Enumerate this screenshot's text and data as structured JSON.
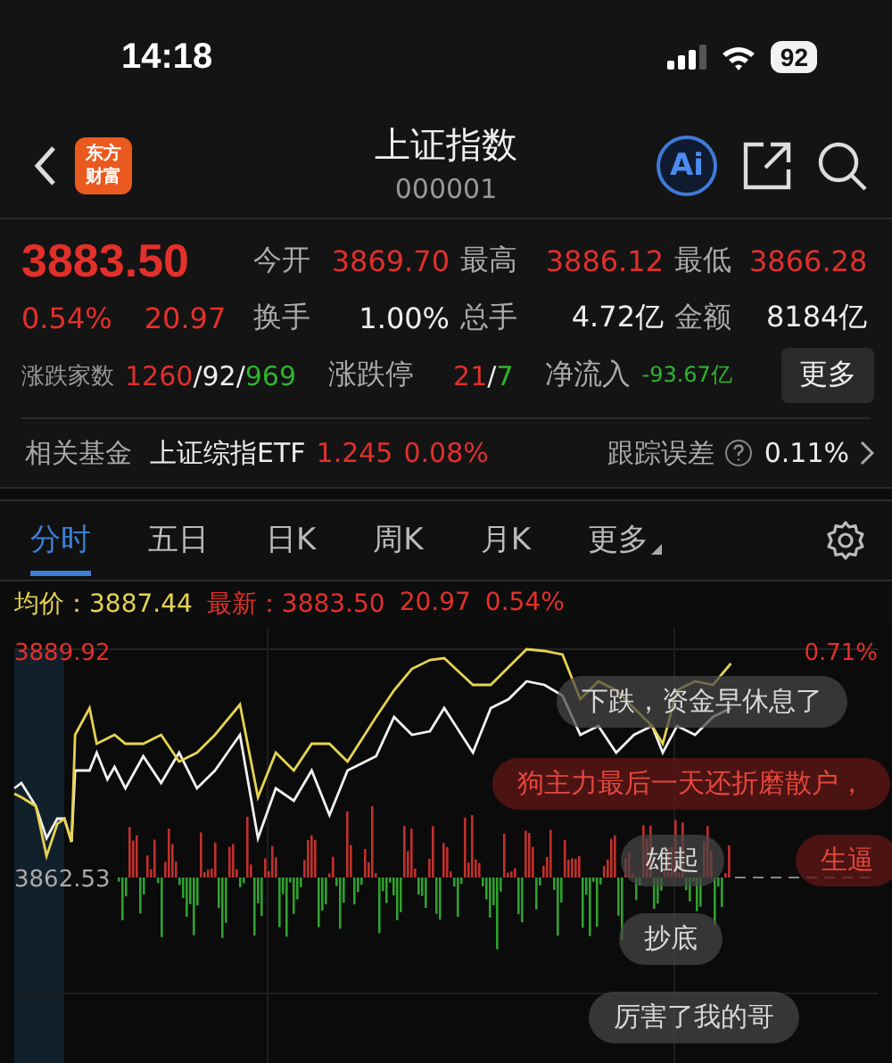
{
  "status_bar": {
    "time": "14:18",
    "battery": "92"
  },
  "header": {
    "logo": [
      "东方",
      "财富"
    ],
    "title": "上证指数",
    "code": "000001",
    "ai_label": "Ai"
  },
  "quote": {
    "price": "3883.50",
    "change_pct": "0.54%",
    "change": "20.97",
    "stats": [
      {
        "label": "今开",
        "value": "3869.70",
        "color": "#e0302c"
      },
      {
        "label": "最高",
        "value": "3886.12",
        "color": "#e0302c"
      },
      {
        "label": "最低",
        "value": "3866.28",
        "color": "#e0302c"
      },
      {
        "label": "换手",
        "value": "1.00%",
        "color": "#eeeeee"
      },
      {
        "label": "总手",
        "value": "4.72亿",
        "color": "#eeeeee"
      },
      {
        "label": "金额",
        "value": "8184亿",
        "color": "#eeeeee"
      }
    ],
    "breadth": {
      "label": "涨跌家数",
      "parts": [
        {
          "text": "1260",
          "color": "#e0302c"
        },
        {
          "text": "/92/",
          "color": "#eeeeee"
        },
        {
          "text": "969",
          "color": "#2fb52f"
        }
      ]
    },
    "limits": {
      "label": "涨跌停",
      "parts": [
        {
          "text": "21",
          "color": "#e0302c"
        },
        {
          "text": "/",
          "color": "#eeeeee"
        },
        {
          "text": "7",
          "color": "#2fb52f"
        }
      ]
    },
    "net_inflow": {
      "label": "净流入",
      "value": "-93.67亿"
    },
    "more_button": "更多"
  },
  "fund": {
    "label": "相关基金",
    "name": "上证综指ETF",
    "price": "1.245",
    "pct": "0.08%",
    "tracking_label": "跟踪误差",
    "tracking_value": "0.11%"
  },
  "tabs": [
    {
      "label": "分时",
      "selected": true,
      "kind": "plain"
    },
    {
      "label": "五日",
      "selected": false,
      "kind": "plain"
    },
    {
      "label": "日K",
      "selected": false,
      "kind": "plain"
    },
    {
      "label": "周K",
      "selected": false,
      "kind": "plain"
    },
    {
      "label": "月K",
      "selected": false,
      "kind": "plain"
    },
    {
      "label": "更多",
      "selected": false,
      "kind": "dropdown"
    }
  ],
  "info": {
    "avg_label": "均价：",
    "avg": "3887.44",
    "latest_label": "最新：",
    "latest": "3883.50",
    "change": "20.97",
    "pct": "0.54%"
  },
  "chart": {
    "top_label": "3889.92",
    "base_label": "3862.53",
    "right_label": "0.71%"
  },
  "comments": [
    {
      "text": "下跌，资金早休息了",
      "kind": "normal"
    },
    {
      "text": "狗主力最后一天还折磨散户，",
      "kind": "highlight"
    },
    {
      "text": "雄起",
      "kind": "normal"
    },
    {
      "text": "生逼",
      "kind": "highlight"
    },
    {
      "text": "抄底",
      "kind": "normal"
    },
    {
      "text": "厉害了我的哥",
      "kind": "normal"
    }
  ]
}
